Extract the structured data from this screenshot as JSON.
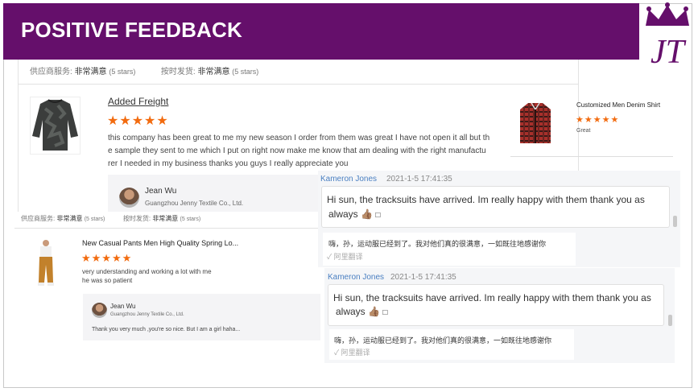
{
  "banner": {
    "title": "POSITIVE FEEDBACK"
  },
  "logo": {
    "text": "JT",
    "color": "#650f6b"
  },
  "colors": {
    "banner": "#650f6b",
    "stars": "#f26b0f",
    "chat_name": "#4a7fc1"
  },
  "card1": {
    "supplier_service_label": "供应商服务:",
    "supplier_service_value": "非常满意",
    "supplier_service_stars": "(5 stars)",
    "ship_label": "按时发货:",
    "ship_value": "非常满意",
    "ship_stars": "(5 stars)",
    "product_title": "Added Freight",
    "stars": "★★★★★",
    "review_line1": "this company has been great to me my new season I order from them was great I have not open it all but th",
    "review_line2": "e sample they sent to me which I put on right now make me know that am dealing with the right manufactu",
    "review_line3": "rer I needed in my business thanks you guys I really appreciate you",
    "reply_name": "Jean Wu",
    "reply_company": "Guangzhou Jenny Textile Co., Ltd."
  },
  "card2": {
    "product_title": "Customized Men Denim Shirt",
    "stars": "★★★★★",
    "review": "Great"
  },
  "card3": {
    "supplier_service_label": "供应商服务:",
    "supplier_service_value": "非常满意",
    "supplier_service_stars": "(5 stars)",
    "ship_label": "按时发货:",
    "ship_value": "非常满意",
    "ship_stars": "(5 stars)",
    "product_title": "New Casual Pants Men High Quality Spring Lo...",
    "stars": "★★★★★",
    "review_line1": "very understanding and working a lot with me",
    "review_line2": "he was so patient",
    "reply_name": "Jean Wu",
    "reply_company": "Guangzhou Jenny Textile Co., Ltd.",
    "reply_text": "Thank you very much ,you're so nice. But I am a girl haha..."
  },
  "chats": [
    {
      "name": "Kameron Jones",
      "time": "2021-1-5 17:41:35",
      "line1": "Hi sun, the tracksuits have arrived. Im really happy with them thank you as",
      "line2": "always",
      "emoji": "👍🏽",
      "box_glyph": "□",
      "translation": "嗨，孙，运动服已经到了。我对他们真的很满意，一如既往地感谢你",
      "translate_label": "✓ 阿里翻译"
    },
    {
      "name": "Kameron Jones",
      "time": "2021-1-5 17:41:35",
      "line1": "Hi sun, the tracksuits have arrived. Im really happy with them thank you as",
      "line2": "always",
      "emoji": "👍🏽",
      "box_glyph": "□",
      "translation": "嗨，孙，运动服已经到了。我对他们真的很满意，一如既往地感谢你",
      "translate_label": "✓ 阿里翻译"
    }
  ]
}
